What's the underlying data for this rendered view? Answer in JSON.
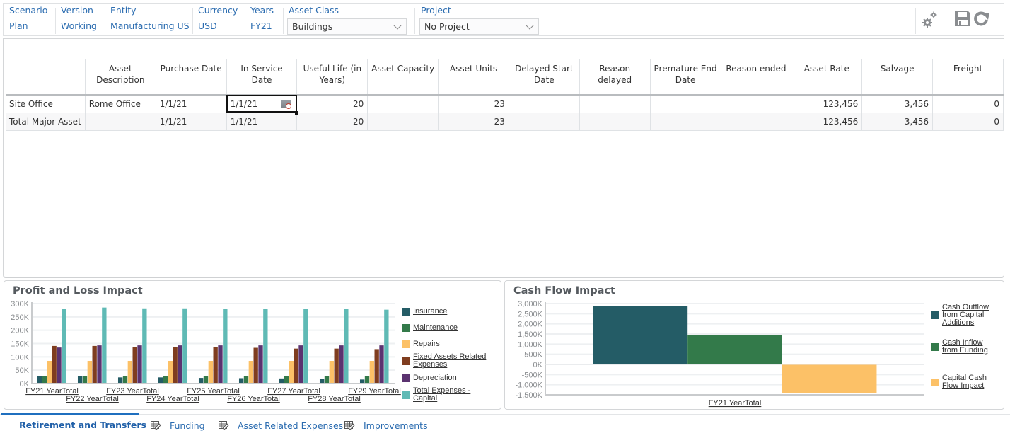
{
  "pov": {
    "items": [
      {
        "label": "Scenario",
        "value": "Plan"
      },
      {
        "label": "Version",
        "value": "Working"
      },
      {
        "label": "Entity",
        "value": "Manufacturing US"
      },
      {
        "label": "Currency",
        "value": "USD"
      },
      {
        "label": "Years",
        "value": "FY21"
      }
    ],
    "asset_class": {
      "label": "Asset Class",
      "selected": "Buildings"
    },
    "project": {
      "label": "Project",
      "selected": "No Project"
    },
    "toolbar": {
      "actions_icon": "gears-icon",
      "save_icon": "save-icon",
      "refresh_icon": "refresh-icon"
    }
  },
  "grid": {
    "columns": [
      "",
      "Asset Description",
      "Purchase Date",
      "In Service Date",
      "Useful Life (in Years)",
      "Asset Capacity",
      "Asset Units",
      "Delayed Start Date",
      "Reason delayed",
      "Premature End Date",
      "Reason ended",
      "Asset Rate",
      "Salvage",
      "Freight"
    ],
    "rows": [
      {
        "cells": [
          "Site Office",
          "Rome Office",
          "1/1/21",
          "1/1/21",
          "20",
          "",
          "23",
          "",
          "",
          "",
          "",
          "123,456",
          "3,456",
          "0"
        ]
      },
      {
        "cells": [
          "Total Major Asset",
          "",
          "1/1/21",
          "1/1/21",
          "20",
          "",
          "23",
          "",
          "",
          "",
          "",
          "123,456",
          "3,456",
          "0"
        ]
      }
    ]
  },
  "chart_data": [
    {
      "type": "bar",
      "title": "Profit and Loss Impact",
      "xlabel": "",
      "ylabel": "",
      "ylim": [
        0,
        300000
      ],
      "yticks": [
        "0K",
        "50K",
        "100K",
        "150K",
        "200K",
        "250K",
        "300K"
      ],
      "categories": [
        "FY21 YearTotal",
        "FY22 YearTotal",
        "FY23 YearTotal",
        "FY24 YearTotal",
        "FY25 YearTotal",
        "FY26 YearTotal",
        "FY27 YearTotal",
        "FY28 YearTotal",
        "FY29 YearTotal"
      ],
      "legend_position": "right",
      "grid": true,
      "series": [
        {
          "name": "Insurance",
          "color": "#245c66",
          "values": [
            27000,
            27000,
            23000,
            23000,
            21000,
            20000,
            19000,
            18000,
            15000
          ]
        },
        {
          "name": "Maintenance",
          "color": "#337a4a",
          "values": [
            29000,
            29000,
            29000,
            29000,
            29000,
            29000,
            29000,
            29000,
            29000
          ]
        },
        {
          "name": "Repairs",
          "color": "#fcc167",
          "values": [
            85000,
            85000,
            85000,
            85000,
            85000,
            85000,
            85000,
            85000,
            85000
          ]
        },
        {
          "name": "Fixed Assets Related Expenses",
          "color": "#7f3d1f",
          "values": [
            141000,
            141000,
            138000,
            138000,
            136000,
            134000,
            131000,
            131000,
            129000
          ]
        },
        {
          "name": "Depreciation",
          "color": "#5b3370",
          "values": [
            135000,
            143000,
            143000,
            143000,
            143000,
            143000,
            143000,
            143000,
            143000
          ]
        },
        {
          "name": "Total Expenses - Capital",
          "color": "#5fbab5",
          "values": [
            280000,
            285000,
            282000,
            282000,
            280000,
            280000,
            279000,
            279000,
            277000
          ]
        }
      ]
    },
    {
      "type": "bar",
      "title": "Cash Flow Impact",
      "xlabel": "",
      "ylabel": "",
      "ylim": [
        -1500000,
        3000000
      ],
      "yticks": [
        "-1,500K",
        "-1,000K",
        "-500K",
        "0K",
        "500K",
        "1,000K",
        "1,500K",
        "2,000K",
        "2,500K",
        "3,000K"
      ],
      "categories": [
        "FY21 YearTotal"
      ],
      "legend_position": "right",
      "grid": true,
      "series": [
        {
          "name": "Cash Outflow from Capital Additions",
          "color": "#245c66",
          "values": [
            2880000
          ]
        },
        {
          "name": "Cash Inflow from Funding",
          "color": "#337a4a",
          "values": [
            1450000
          ]
        },
        {
          "name": "Capital Cash Flow Impact",
          "color": "#fcc167",
          "values": [
            -1430000
          ]
        }
      ]
    }
  ],
  "tabs": [
    {
      "label": "Retirement and Transfers",
      "active": true,
      "icon": "grid-edit-icon"
    },
    {
      "label": "Funding",
      "active": false,
      "icon": "grid-edit-icon"
    },
    {
      "label": "Asset Related Expenses",
      "active": false,
      "icon": "grid-edit-icon"
    },
    {
      "label": "Improvements",
      "active": false,
      "icon": "grid-edit-icon"
    }
  ]
}
